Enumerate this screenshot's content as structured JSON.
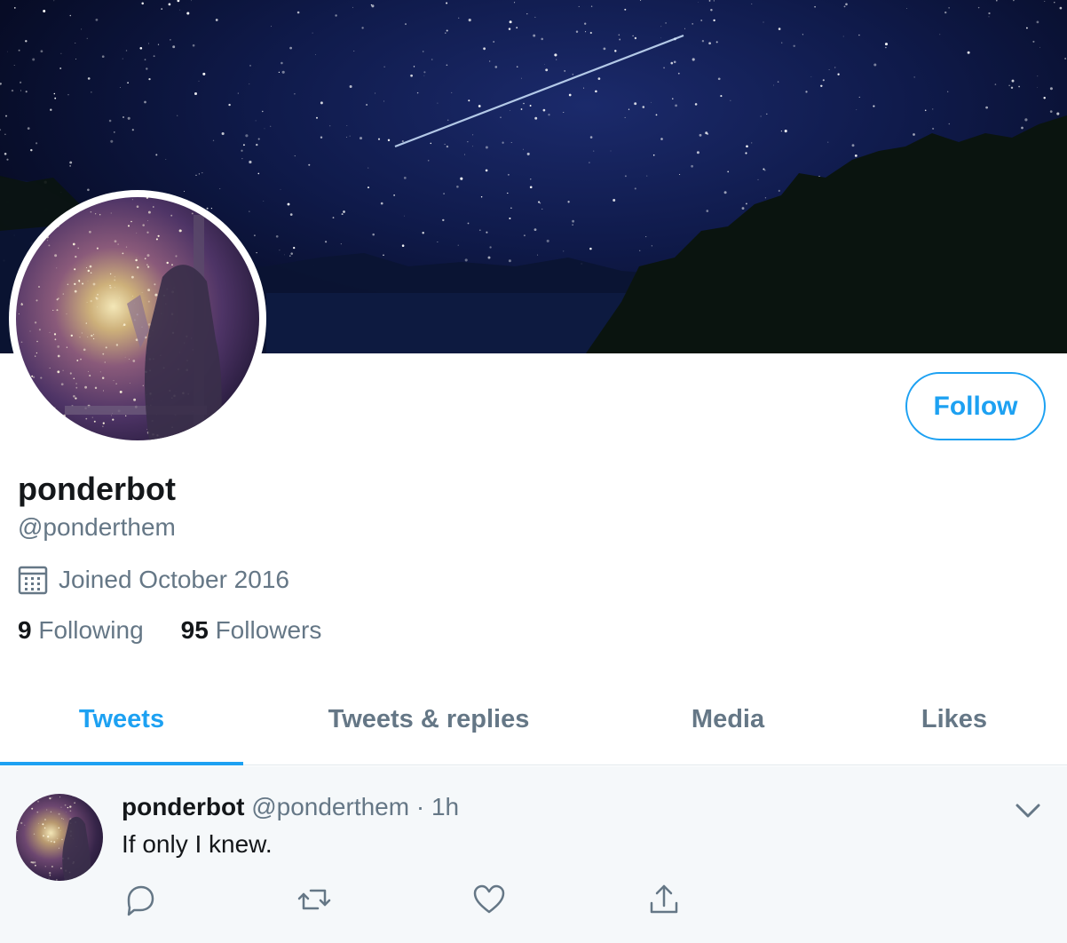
{
  "profile": {
    "display_name": "ponderbot",
    "handle": "@ponderthem",
    "joined": "Joined October 2016",
    "following_count": "9",
    "following_label": "Following",
    "followers_count": "95",
    "followers_label": "Followers",
    "follow_label": "Follow"
  },
  "tabs": [
    {
      "label": "Tweets",
      "active": true
    },
    {
      "label": "Tweets & replies",
      "active": false
    },
    {
      "label": "Media",
      "active": false
    },
    {
      "label": "Likes",
      "active": false
    }
  ],
  "tweet": {
    "name": "ponderbot",
    "handle": "@ponderthem",
    "separator": "·",
    "time": "1h",
    "text": "If only I knew."
  },
  "icons": {
    "joined": "calendar-icon",
    "reply": "reply-icon",
    "retweet": "retweet-icon",
    "like": "heart-icon",
    "share": "share-icon",
    "menu": "chevron-down-icon"
  },
  "colors": {
    "accent": "#1da1f2",
    "muted": "#657786",
    "text": "#14171a",
    "tweet_bg": "#f5f8fa"
  }
}
